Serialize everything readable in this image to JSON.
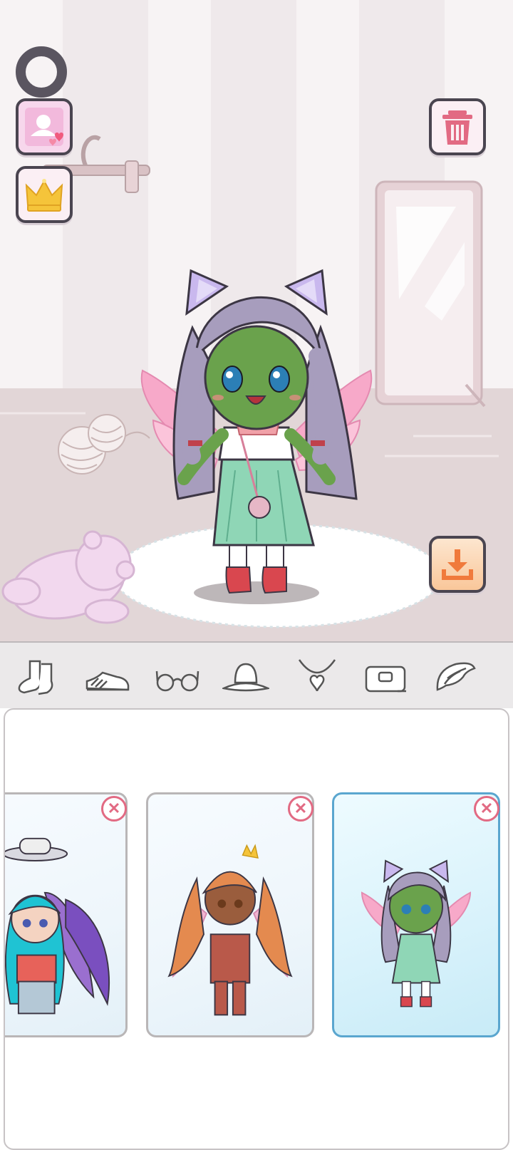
{
  "screen": "avatar-dressup-editor",
  "colors": {
    "accent_pink": "#e26a83",
    "button_border": "#4a4550",
    "download_orange": "#f07a3c",
    "selected_card_border": "#5aa6cf",
    "crown_gold": "#f5c43a"
  },
  "top_left_controls": [
    {
      "name": "settings",
      "icon": "ring-icon"
    },
    {
      "name": "favorites",
      "icon": "avatar-hearts-icon"
    },
    {
      "name": "premium",
      "icon": "crown-icon"
    }
  ],
  "top_right_controls": [
    {
      "name": "delete",
      "icon": "trash-icon"
    }
  ],
  "bottom_right_controls": [
    {
      "name": "save",
      "icon": "download-icon"
    }
  ],
  "categories": [
    {
      "name": "socks",
      "icon": "socks-icon"
    },
    {
      "name": "shoes",
      "icon": "shoes-icon"
    },
    {
      "name": "glasses",
      "icon": "glasses-icon"
    },
    {
      "name": "hats",
      "icon": "hat-icon"
    },
    {
      "name": "necklaces",
      "icon": "necklace-icon"
    },
    {
      "name": "bags",
      "icon": "bag-icon"
    },
    {
      "name": "wings",
      "icon": "wing-icon"
    }
  ],
  "saved_characters": [
    {
      "name": "teal-hair-character",
      "selected": false,
      "hair": "#1fc3d3",
      "skin": "#f4d3c1",
      "outfit": "#e7625a"
    },
    {
      "name": "orange-hair-character",
      "selected": false,
      "hair": "#e48a4f",
      "skin": "#9a5d3d",
      "outfit": "#b9594a"
    },
    {
      "name": "lavender-hair-character",
      "selected": true,
      "hair": "#a79dbd",
      "skin": "#6aa24c",
      "outfit": "#8fd6b6"
    }
  ]
}
